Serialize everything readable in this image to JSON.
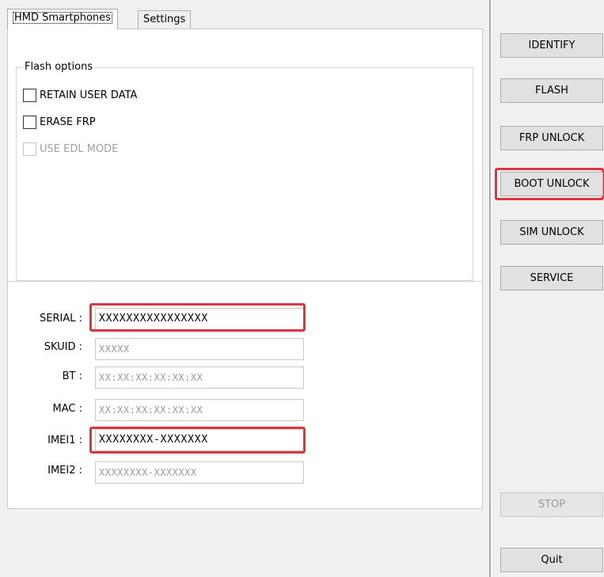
{
  "tabs": [
    {
      "label": "HMD Smartphones",
      "active": true
    },
    {
      "label": "Settings",
      "active": false
    }
  ],
  "flash_options": {
    "title": "Flash options",
    "checkboxes": [
      {
        "label": "RETAIN USER DATA",
        "checked": false,
        "enabled": true
      },
      {
        "label": "ERASE FRP",
        "checked": false,
        "enabled": true
      },
      {
        "label": "USE EDL MODE",
        "checked": false,
        "enabled": false
      }
    ]
  },
  "fields": {
    "serial": {
      "label": "SERIAL :",
      "value": "XXXXXXXXXXXXXXXX"
    },
    "skuid": {
      "label": "SKUID :",
      "value": "XXXXX"
    },
    "bt": {
      "label": "BT :",
      "value": "XX:XX:XX:XX:XX:XX"
    },
    "mac": {
      "label": "MAC :",
      "value": "XX:XX:XX:XX:XX:XX"
    },
    "imei1": {
      "label": "IMEI1 :",
      "value": "XXXXXXXX-XXXXXXX"
    },
    "imei2": {
      "label": "IMEI2 :",
      "value": "XXXXXXXX-XXXXXXX"
    }
  },
  "buttons": {
    "identify": "IDENTIFY",
    "flash": "FLASH",
    "frp_unlock": "FRP UNLOCK",
    "boot_unlock": "BOOT UNLOCK",
    "sim_unlock": "SIM UNLOCK",
    "service": "SERVICE",
    "stop": "STOP",
    "quit": "Quit"
  },
  "colors": {
    "highlight": "#d9363e",
    "window_bg": "#f0f0f0",
    "panel_bg": "#ffffff"
  }
}
